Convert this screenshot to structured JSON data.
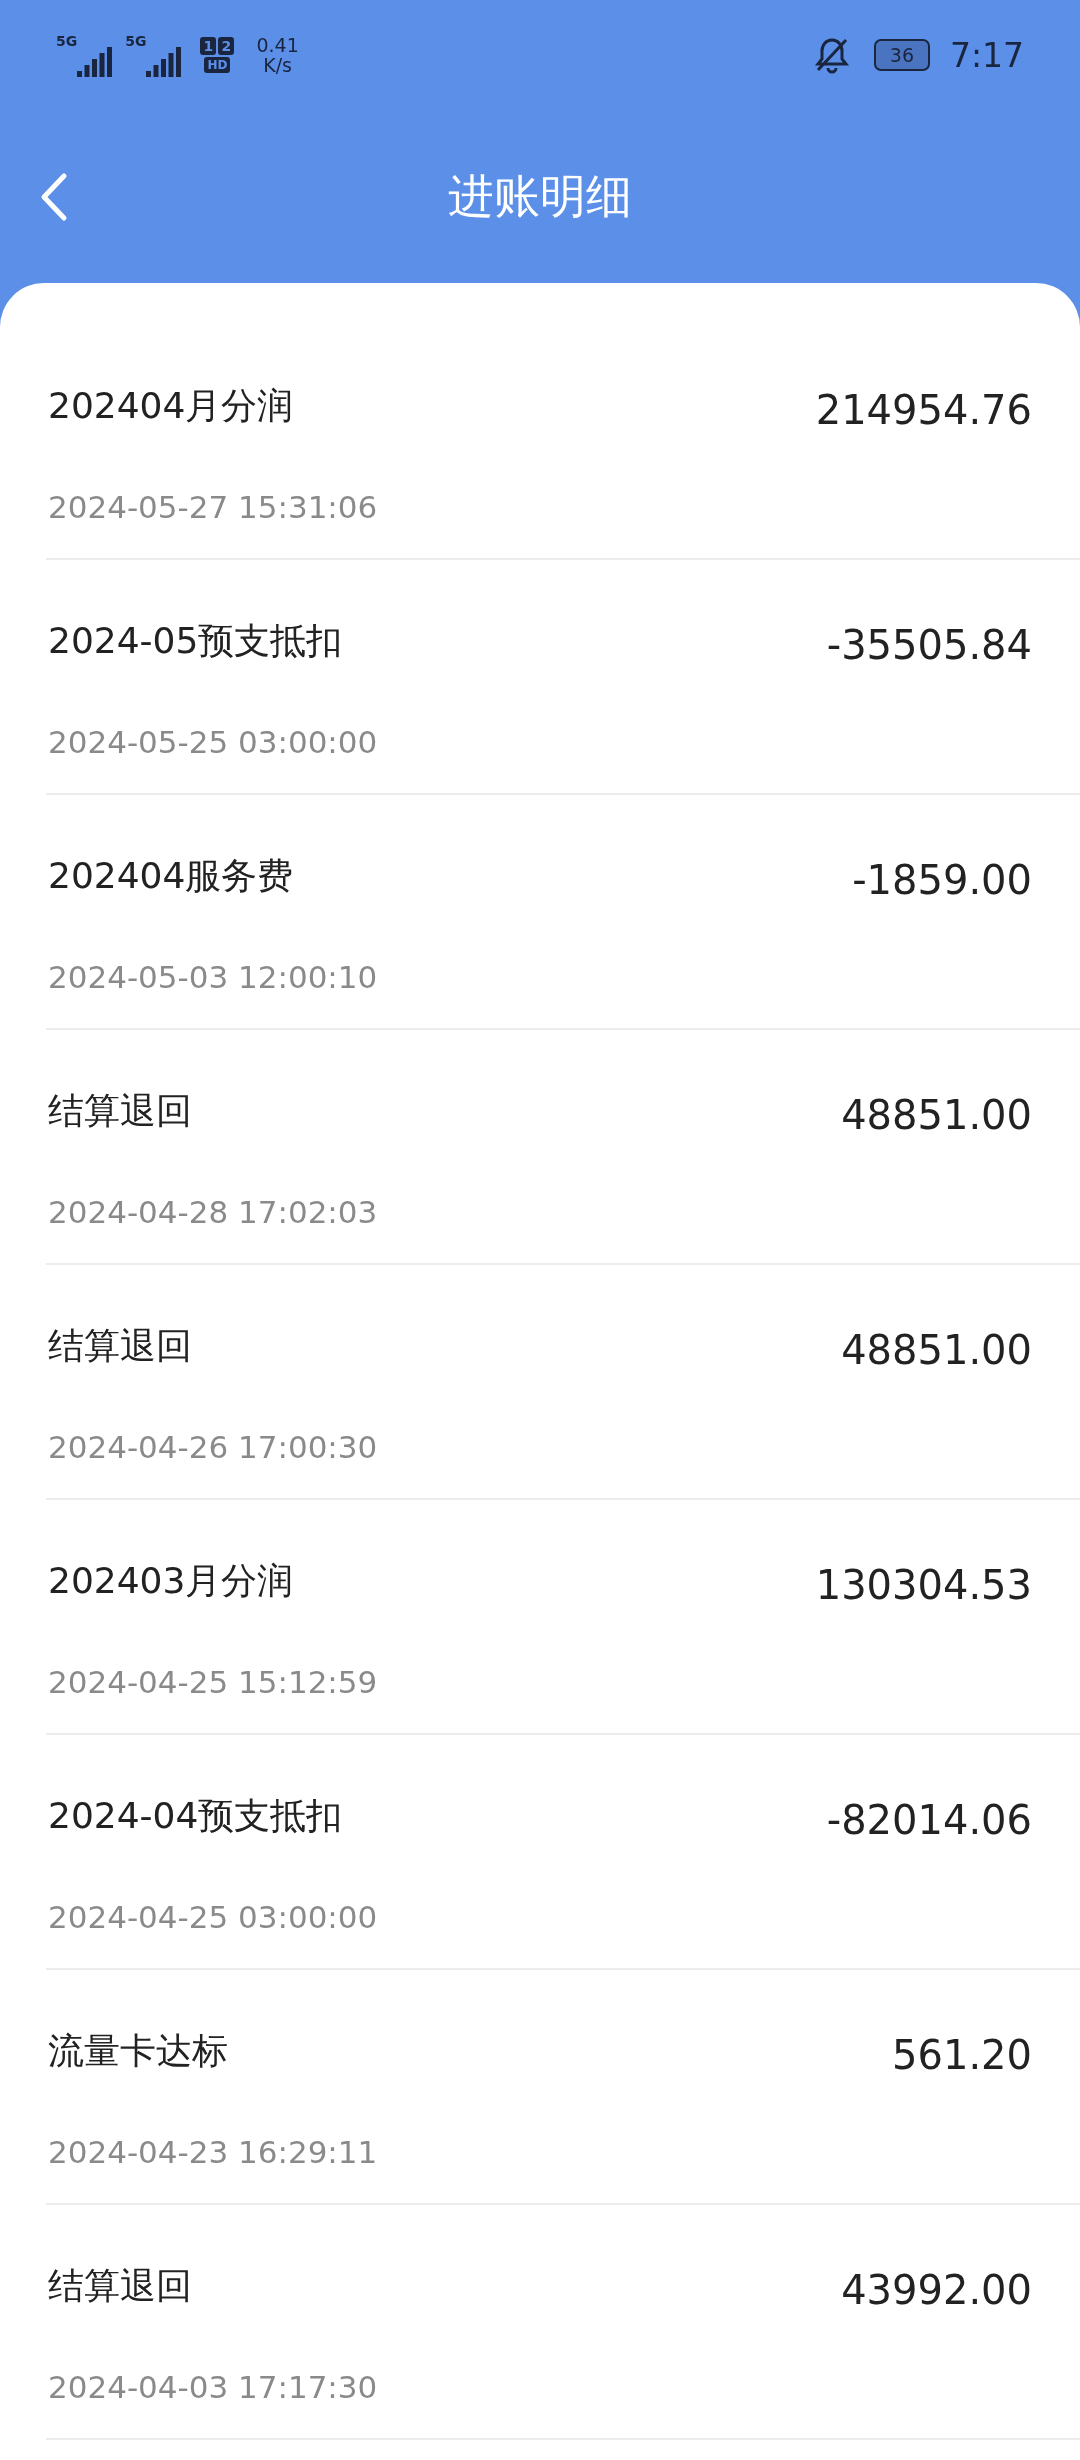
{
  "status_bar": {
    "signals": [
      {
        "label": "5G"
      },
      {
        "label": "5G"
      }
    ],
    "sim_badge": {
      "sims": [
        "1",
        "2"
      ],
      "label": "HD"
    },
    "speed": {
      "value": "0.41",
      "unit": "K/s"
    },
    "battery": "36",
    "time": "7:17"
  },
  "header": {
    "title": "进账明细"
  },
  "entries": [
    {
      "title": "202404月分润",
      "date": "2024-05-27 15:31:06",
      "amount": "214954.76"
    },
    {
      "title": "2024-05预支抵扣",
      "date": "2024-05-25 03:00:00",
      "amount": "-35505.84"
    },
    {
      "title": "202404服务费",
      "date": "2024-05-03 12:00:10",
      "amount": "-1859.00"
    },
    {
      "title": "结算退回",
      "date": "2024-04-28 17:02:03",
      "amount": "48851.00"
    },
    {
      "title": "结算退回",
      "date": "2024-04-26 17:00:30",
      "amount": "48851.00"
    },
    {
      "title": "202403月分润",
      "date": "2024-04-25 15:12:59",
      "amount": "130304.53"
    },
    {
      "title": "2024-04预支抵扣",
      "date": "2024-04-25 03:00:00",
      "amount": "-82014.06"
    },
    {
      "title": "流量卡达标",
      "date": "2024-04-23 16:29:11",
      "amount": "561.20"
    },
    {
      "title": "结算退回",
      "date": "2024-04-03 17:17:30",
      "amount": "43992.00"
    }
  ]
}
